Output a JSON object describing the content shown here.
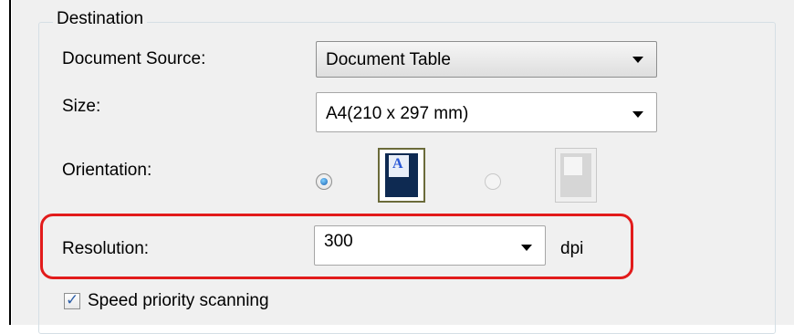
{
  "destination": {
    "group_title": "Destination",
    "document_source": {
      "label": "Document Source:",
      "value": "Document Table"
    },
    "size": {
      "label": "Size:",
      "value": "A4(210 x 297 mm)"
    },
    "orientation": {
      "label": "Orientation:",
      "options": [
        {
          "name": "portrait",
          "selected": true,
          "icon": "portrait-page-icon"
        },
        {
          "name": "landscape",
          "selected": false,
          "icon": "landscape-page-icon"
        }
      ]
    },
    "resolution": {
      "label": "Resolution:",
      "value": "300",
      "unit": "dpi"
    },
    "speed_priority": {
      "label": "Speed priority scanning",
      "checked": true
    }
  },
  "colors": {
    "highlight": "#e21b1b",
    "radio_selected": "#1a5fb0",
    "checkbox_mark": "#2e5fa8"
  }
}
